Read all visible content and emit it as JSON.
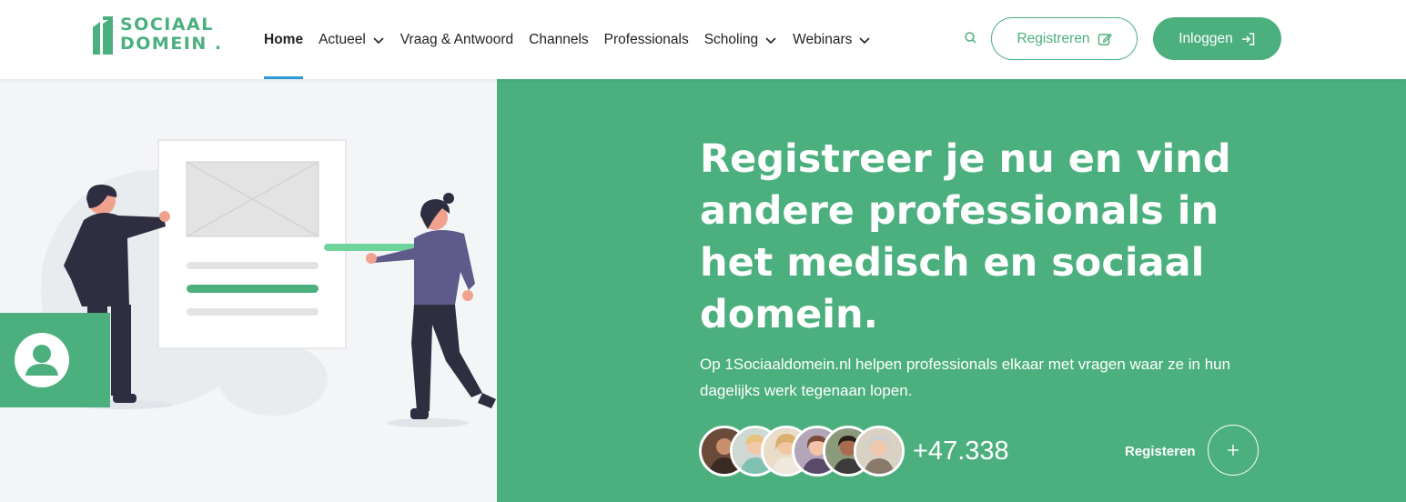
{
  "brand": {
    "logo_line1": "SOCIAAL",
    "logo_line2": "DOMEIN .",
    "green": "#4bb07e",
    "accent_blue": "#2e9bd6"
  },
  "nav": {
    "items": [
      {
        "label": "Home",
        "active": true,
        "dropdown": false
      },
      {
        "label": "Actueel",
        "active": false,
        "dropdown": true
      },
      {
        "label": "Vraag & Antwoord",
        "active": false,
        "dropdown": false
      },
      {
        "label": "Channels",
        "active": false,
        "dropdown": false
      },
      {
        "label": "Professionals",
        "active": false,
        "dropdown": false
      },
      {
        "label": "Scholing",
        "active": false,
        "dropdown": true
      },
      {
        "label": "Webinars",
        "active": false,
        "dropdown": true
      }
    ],
    "search_icon": "search-icon",
    "register_label": "Registreren",
    "register_icon": "edit-icon",
    "login_label": "Inloggen",
    "login_icon": "sign-in-icon"
  },
  "hero": {
    "headline": "Registreer je nu en vind andere professionals in het medisch en sociaal domein.",
    "subtext": "Op 1Sociaaldomein.nl helpen professionals elkaar met vragen waar ze in hun dagelijks werk tegenaan lopen.",
    "member_count": "+47.338",
    "register_link": "Registeren",
    "plus_icon": "plus-icon",
    "avatar_icon": "user-circle-icon"
  }
}
